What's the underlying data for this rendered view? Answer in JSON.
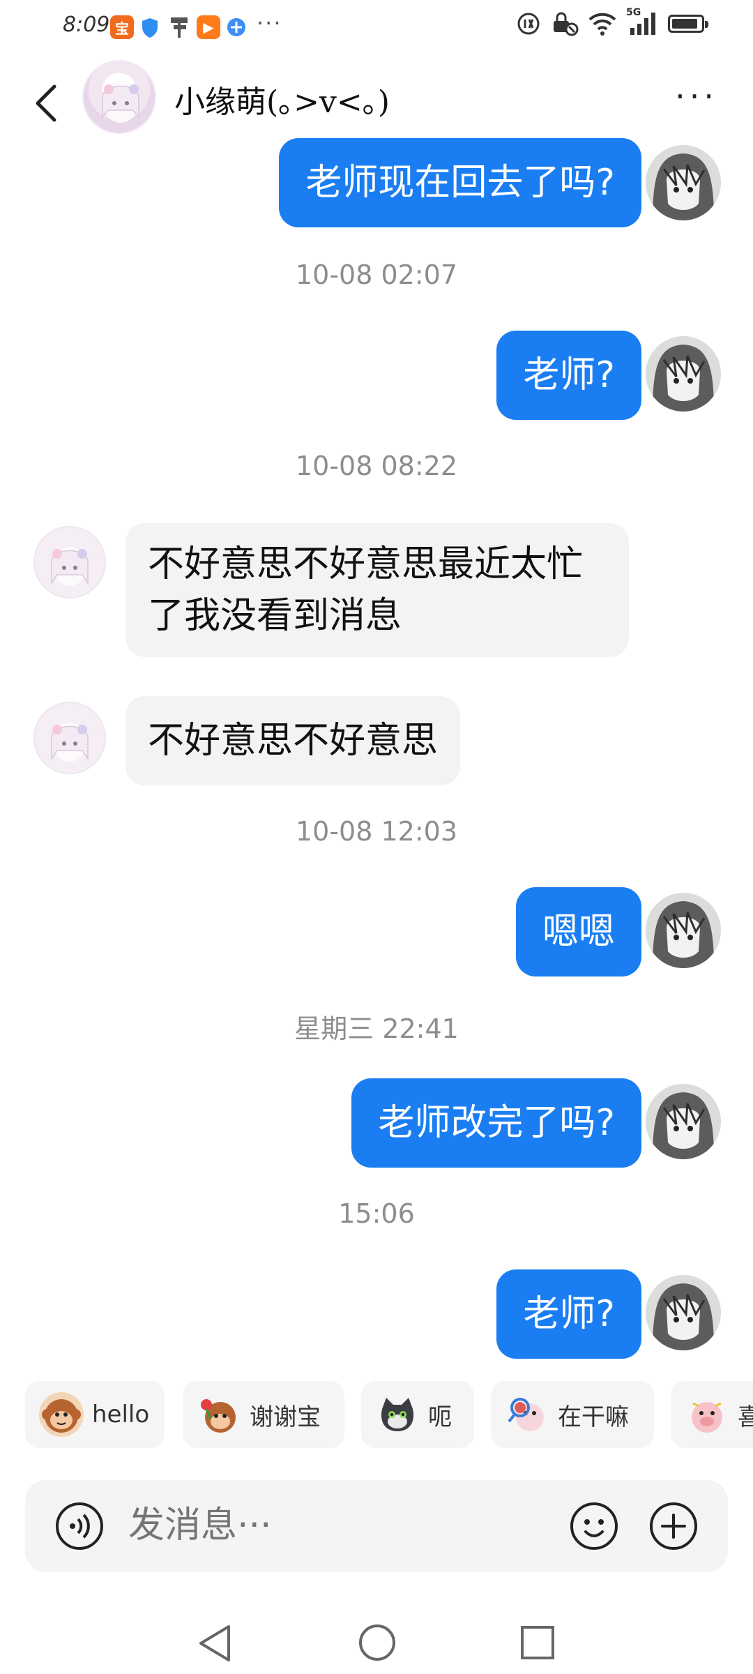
{
  "status_bar": {
    "time": "8:09",
    "network": "5G",
    "more": "···"
  },
  "header": {
    "contact_name": "小缘萌(｡>v<｡)",
    "more": "···"
  },
  "messages": [
    {
      "side": "out",
      "text": "老师现在回去了吗?"
    },
    {
      "timestamp": "10-08 02:07"
    },
    {
      "side": "out",
      "text": "老师?"
    },
    {
      "timestamp": "10-08 08:22"
    },
    {
      "side": "in",
      "text": "不好意思不好意思最近太忙了我没看到消息"
    },
    {
      "side": "in",
      "text": "不好意思不好意思"
    },
    {
      "timestamp": "10-08 12:03"
    },
    {
      "side": "out",
      "text": "嗯嗯"
    },
    {
      "timestamp": "星期三 22:41"
    },
    {
      "side": "out",
      "text": "老师改完了吗?"
    },
    {
      "timestamp": "15:06"
    },
    {
      "side": "out",
      "text": "老师?"
    }
  ],
  "quick_replies": [
    {
      "label": "hello",
      "icon": "monkey-emoji-icon"
    },
    {
      "label": "谢谢宝",
      "icon": "monkey-rose-emoji-icon"
    },
    {
      "label": "呃",
      "icon": "cat-emoji-icon"
    },
    {
      "label": "在干嘛",
      "icon": "magnifier-emoji-icon"
    },
    {
      "label": "喜",
      "icon": "pig-emoji-icon"
    }
  ],
  "input": {
    "placeholder": "发消息···"
  },
  "colors": {
    "accent": "#1a7ef2",
    "incoming_bubble": "#f3f3f4",
    "timestamp": "#8d8d8d"
  }
}
